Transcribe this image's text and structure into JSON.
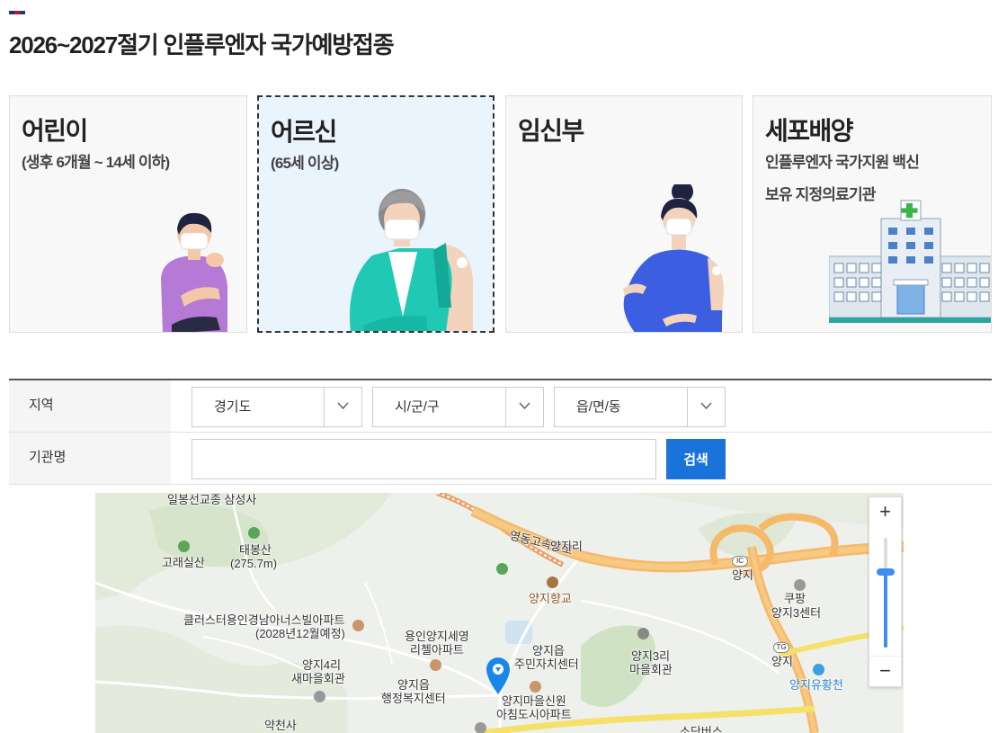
{
  "page": {
    "title": "2026~2027절기 인플루엔자 국가예방접종",
    "accent_colors": [
      "#1f3a7a",
      "#c8102e",
      "#1f3a7a"
    ]
  },
  "cards": [
    {
      "title": "어린이",
      "subtitle": "(생후 6개월 ~ 14세 이하)",
      "selected": false
    },
    {
      "title": "어르신",
      "subtitle": "(65세 이상)",
      "selected": true
    },
    {
      "title": "임신부",
      "subtitle": "",
      "selected": false
    },
    {
      "title": "세포배양",
      "subtitle": "인플루엔자 국가지원 백신",
      "subtitle2": "보유 지정의료기관",
      "selected": false
    }
  ],
  "search": {
    "region_label": "지역",
    "province_value": "경기도",
    "city_value": "시/군/구",
    "town_value": "읍/면/동",
    "institution_label": "기관명",
    "institution_value": "",
    "search_button": "검색"
  },
  "map": {
    "labels": {
      "temple_top": "일봉선교종 삼성사",
      "mountain1": "고래실산",
      "mountain2_name": "태봉산",
      "mountain2_height": "(275.7m)",
      "highway": "영동고속도로",
      "village1": "양지리",
      "school": "양지향교",
      "ic": "IC",
      "ic_name": "양지",
      "coupang1": "쿠팡",
      "coupang2": "양지3센터",
      "apt1_line1": "클러스터용인경남아너스빌아파트",
      "apt1_line2": "(2028년12월예정)",
      "apt2_line1": "용인양지세영",
      "apt2_line2": "리첼아파트",
      "office1_line1": "양지읍",
      "office1_line2": "주민자치센터",
      "hall3_line1": "양지3리",
      "hall3_line2": "마을회관",
      "tg": "TG",
      "tg_name": "양지",
      "stream": "양지유황천",
      "hall4_line1": "양지4리",
      "hall4_line2": "새마을회관",
      "office2_line1": "양지읍",
      "office2_line2": "행정복지센터",
      "apt3_line1": "양지마을신원",
      "apt3_line2": "아침도시아파트",
      "pharmacy": "약천사",
      "bottom": "소단버스"
    },
    "zoom_in": "+",
    "zoom_out": "−",
    "zoom_level_fraction": 0.68
  },
  "icons": {
    "chevron": "chevron-down-icon",
    "zoom_in": "plus-icon",
    "zoom_out": "minus-icon",
    "marker": "map-pin-icon"
  }
}
